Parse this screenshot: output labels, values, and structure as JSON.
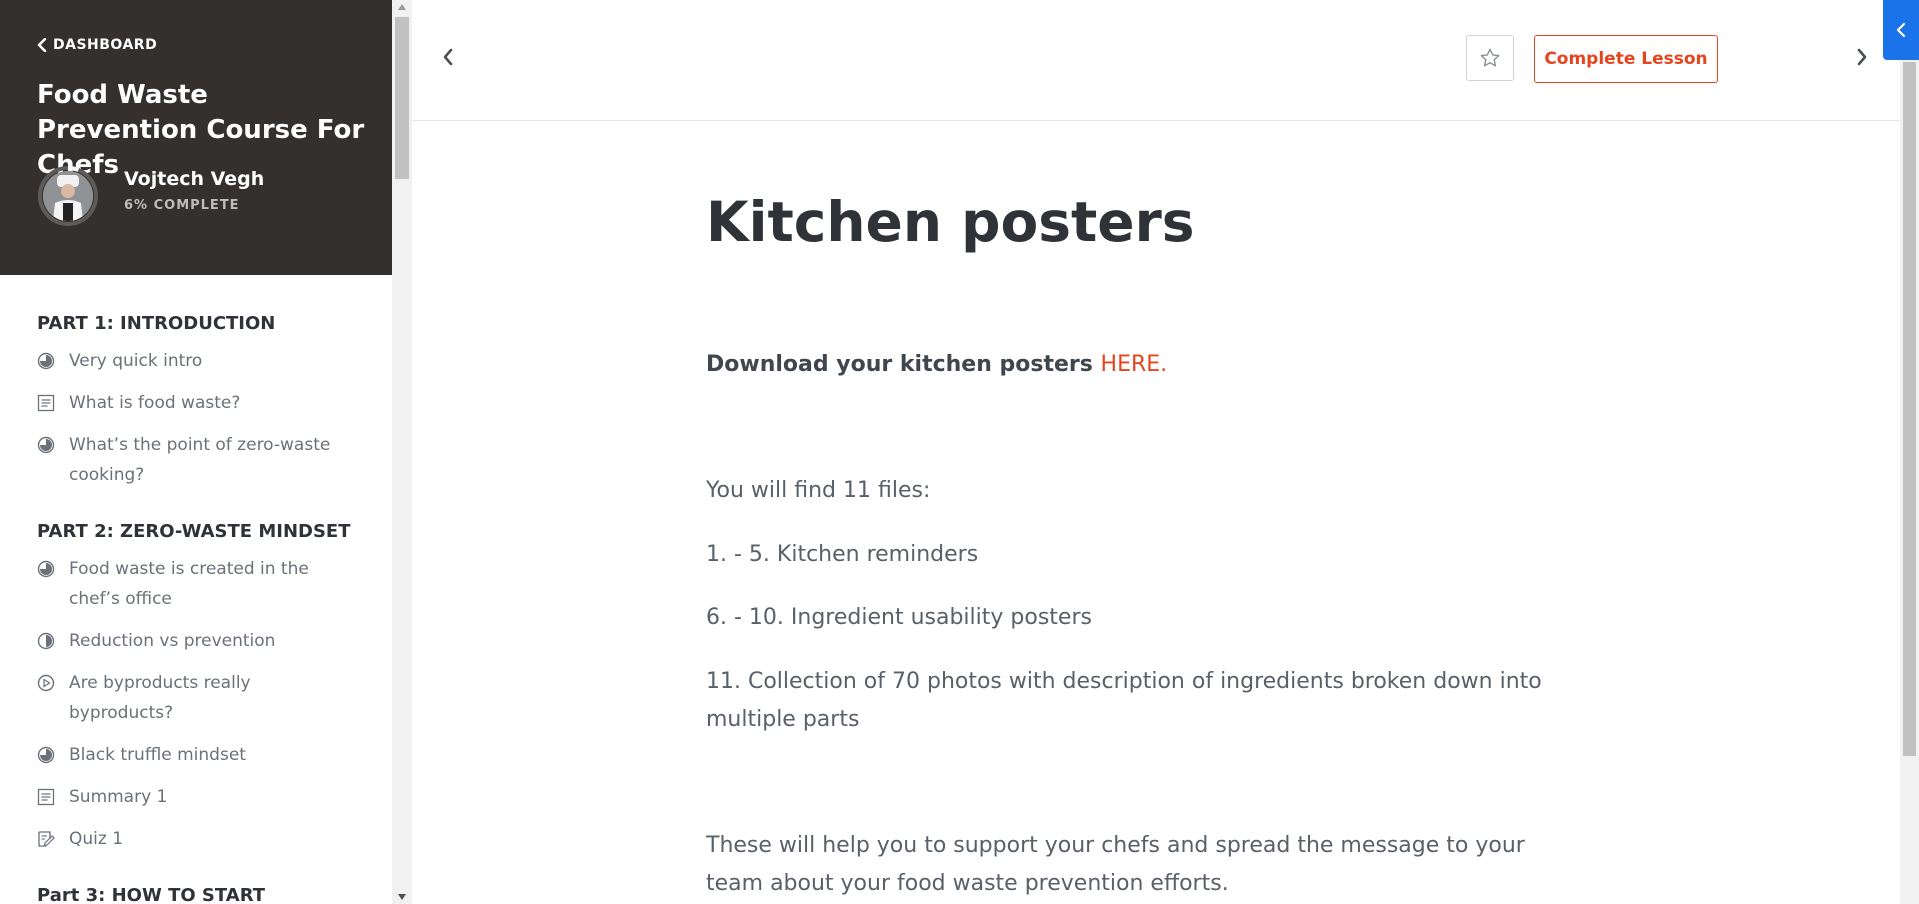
{
  "sidebar": {
    "back_label": "DASHBOARD",
    "course_title": "Food Waste Prevention Course For Chefs",
    "user_name": "Vojtech Vegh",
    "progress_text": "6% COMPLETE",
    "progress_percent": 6,
    "sections": [
      {
        "title": "PART 1: INTRODUCTION",
        "lessons": [
          {
            "label": "Very quick intro",
            "icon": "progress-circle-icon"
          },
          {
            "label": "What is food waste?",
            "icon": "text-document-icon"
          },
          {
            "label": "What’s the point of zero-waste cooking?",
            "icon": "progress-circle-icon"
          }
        ]
      },
      {
        "title": "PART 2: ZERO-WASTE MINDSET",
        "lessons": [
          {
            "label": "Food waste is created in the chef’s office",
            "icon": "progress-circle-icon"
          },
          {
            "label": "Reduction vs prevention",
            "icon": "progress-circle-icon"
          },
          {
            "label": "Are byproducts really byproducts?",
            "icon": "play-circle-icon"
          },
          {
            "label": "Black truffle mindset",
            "icon": "progress-circle-icon"
          },
          {
            "label": "Summary 1",
            "icon": "text-document-icon"
          },
          {
            "label": "Quiz 1",
            "icon": "quiz-icon"
          }
        ]
      },
      {
        "title": "Part 3: HOW TO START",
        "lessons": []
      }
    ]
  },
  "toolbar": {
    "complete_label": "Complete Lesson"
  },
  "lesson": {
    "title": "Kitchen posters",
    "download_text": "Download your kitchen posters ",
    "download_link": "HERE",
    "download_period": ".",
    "files_intro": "You will find 11 files:",
    "item1": "1. - 5. Kitchen reminders",
    "item2": "6. - 10. Ingredient usability posters",
    "item3": "11. Collection of 70 photos with description of ingredients broken down into multiple parts",
    "closing": "These will help you to support your chefs and spread the message to your team about your food waste prevention efforts."
  },
  "colors": {
    "accent": "#e4451e",
    "sidebar_header_bg": "#33302e",
    "float_tab": "#1a73e8"
  }
}
